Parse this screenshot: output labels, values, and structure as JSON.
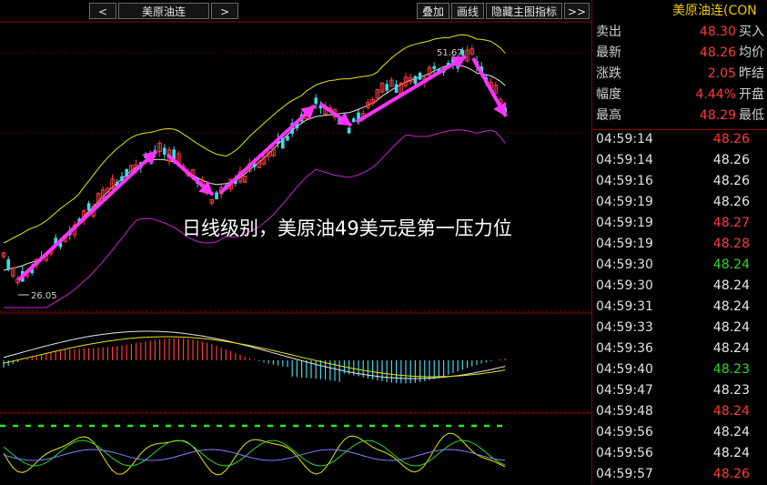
{
  "toolbar": {
    "prev": "<",
    "symbol": "美原油连",
    "next": ">",
    "overlay": "叠加",
    "draw": "画线",
    "hide_indicator": "隐藏主图指标",
    "more": ">>"
  },
  "chart": {
    "high_label": "51.67",
    "low_label": "26.05",
    "annotation": "日线级别，美原油49美元是第一压力位"
  },
  "panel": {
    "title": "美原油连(CON",
    "quotes": [
      {
        "label": "卖出",
        "value": "48.30",
        "label2": "买入",
        "color": "red"
      },
      {
        "label": "最新",
        "value": "48.26",
        "label2": "均价",
        "color": "red"
      },
      {
        "label": "涨跌",
        "value": "2.05",
        "label2": "昨结",
        "color": "red"
      },
      {
        "label": "幅度",
        "value": "4.44%",
        "label2": "开盘",
        "color": "red"
      },
      {
        "label": "最高",
        "value": "48.29",
        "label2": "最低",
        "color": "red"
      }
    ],
    "ticks": [
      {
        "time": "04:59:14",
        "price": "48.26",
        "color": "red"
      },
      {
        "time": "04:59:14",
        "price": "48.26",
        "color": "white"
      },
      {
        "time": "04:59:16",
        "price": "48.26",
        "color": "white"
      },
      {
        "time": "04:59:19",
        "price": "48.26",
        "color": "white"
      },
      {
        "time": "04:59:19",
        "price": "48.27",
        "color": "red"
      },
      {
        "time": "04:59:19",
        "price": "48.28",
        "color": "red"
      },
      {
        "time": "04:59:30",
        "price": "48.24",
        "color": "green"
      },
      {
        "time": "04:59:30",
        "price": "48.24",
        "color": "white"
      },
      {
        "time": "04:59:31",
        "price": "48.24",
        "color": "white"
      },
      {
        "time": "04:59:33",
        "price": "48.24",
        "color": "white"
      },
      {
        "time": "04:59:36",
        "price": "48.24",
        "color": "white"
      },
      {
        "time": "04:59:40",
        "price": "48.23",
        "color": "green"
      },
      {
        "time": "04:59:47",
        "price": "48.23",
        "color": "white"
      },
      {
        "time": "04:59:48",
        "price": "48.24",
        "color": "red"
      },
      {
        "time": "04:59:56",
        "price": "48.24",
        "color": "white"
      },
      {
        "time": "04:59:56",
        "price": "48.24",
        "color": "white"
      },
      {
        "time": "04:59:57",
        "price": "48.26",
        "color": "red"
      }
    ]
  },
  "colors": {
    "up": "#ff3b3b",
    "down": "#3fd8e8",
    "arrow": "#ff33ff",
    "boll_upper": "#e6e600",
    "boll_mid": "#e6e6e6",
    "boll_lower": "#d020d0"
  }
}
